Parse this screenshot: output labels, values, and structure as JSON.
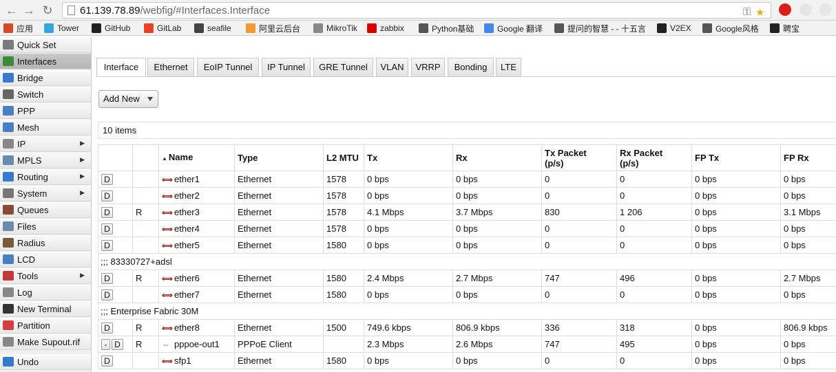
{
  "browser": {
    "url_host": "61.139.78.89",
    "url_path": "/webfig/#Interfaces.Interface"
  },
  "bookmarks": [
    {
      "label": "应用",
      "icon": "apps-grid-icon",
      "color": "#d04a30"
    },
    {
      "label": "Tower",
      "icon": "tower-icon",
      "color": "#3aa5d8"
    },
    {
      "label": "GitHub",
      "icon": "github-icon",
      "color": "#222222"
    },
    {
      "label": "GitLab",
      "icon": "gitlab-icon",
      "color": "#e2432a"
    },
    {
      "label": "seafile",
      "icon": "cloud-icon",
      "color": "#444444"
    },
    {
      "label": "阿里云后台",
      "icon": "aliyun-icon",
      "color": "#f29a38"
    },
    {
      "label": "MikroTik",
      "icon": "page-icon",
      "color": "#888888"
    },
    {
      "label": "zabbix",
      "icon": "zabbix-icon",
      "color": "#d40000"
    },
    {
      "label": "Python基础",
      "icon": "page-icon",
      "color": "#555555"
    },
    {
      "label": "Google 翻译",
      "icon": "translate-icon",
      "color": "#4a86e8"
    },
    {
      "label": "提问的智慧 - - 十五言",
      "icon": "page-icon",
      "color": "#555555"
    },
    {
      "label": "V2EX",
      "icon": "v2ex-icon",
      "color": "#222222"
    },
    {
      "label": "Google风格",
      "icon": "grid-icon",
      "color": "#555555"
    },
    {
      "label": "聘宝",
      "icon": "pinbao-icon",
      "color": "#222222"
    }
  ],
  "sidebar": {
    "items": [
      {
        "label": "Quick Set",
        "icon": "quick-set-icon",
        "color": "#7a7a7a",
        "arrow": ""
      },
      {
        "label": "Interfaces",
        "icon": "interfaces-icon",
        "color": "#3b8a3b",
        "arrow": ""
      },
      {
        "label": "Bridge",
        "icon": "bridge-icon",
        "color": "#3a78c8",
        "arrow": ""
      },
      {
        "label": "Switch",
        "icon": "switch-icon",
        "color": "#666666",
        "arrow": ""
      },
      {
        "label": "PPP",
        "icon": "ppp-icon",
        "color": "#4a7fc0",
        "arrow": ""
      },
      {
        "label": "Mesh",
        "icon": "mesh-icon",
        "color": "#4a7fc0",
        "arrow": ""
      },
      {
        "label": "IP",
        "icon": "ip-icon",
        "color": "#888888",
        "arrow": "▶"
      },
      {
        "label": "MPLS",
        "icon": "mpls-icon",
        "color": "#6a8ab0",
        "arrow": "▶"
      },
      {
        "label": "Routing",
        "icon": "routing-icon",
        "color": "#3a78c8",
        "arrow": "▶"
      },
      {
        "label": "System",
        "icon": "gear-icon",
        "color": "#777777",
        "arrow": "▶"
      },
      {
        "label": "Queues",
        "icon": "queues-icon",
        "color": "#8a4a3a",
        "arrow": ""
      },
      {
        "label": "Files",
        "icon": "files-icon",
        "color": "#6a8ab0",
        "arrow": ""
      },
      {
        "label": "Radius",
        "icon": "radius-icon",
        "color": "#7a5a3a",
        "arrow": ""
      },
      {
        "label": "LCD",
        "icon": "lcd-icon",
        "color": "#4a7fc0",
        "arrow": ""
      },
      {
        "label": "Tools",
        "icon": "tools-icon",
        "color": "#c03a3a",
        "arrow": "▶"
      },
      {
        "label": "Log",
        "icon": "log-icon",
        "color": "#888888",
        "arrow": ""
      },
      {
        "label": "New Terminal",
        "icon": "terminal-icon",
        "color": "#333333",
        "arrow": ""
      },
      {
        "label": "Partition",
        "icon": "partition-icon",
        "color": "#d04040",
        "arrow": ""
      },
      {
        "label": "Make Supout.rif",
        "icon": "supout-icon",
        "color": "#888888",
        "arrow": ""
      },
      {
        "label": "Undo",
        "icon": "undo-icon",
        "color": "#3a78c8",
        "arrow": ""
      }
    ]
  },
  "tabs": [
    "Interface",
    "Ethernet",
    "EoIP Tunnel",
    "IP Tunnel",
    "GRE Tunnel",
    "VLAN",
    "VRRP",
    "Bonding",
    "LTE"
  ],
  "toolbar": {
    "add_new_label": "Add New"
  },
  "items_count": "10 items",
  "table": {
    "columns": [
      "",
      "",
      "Name",
      "Type",
      "L2 MTU",
      "Tx",
      "Rx",
      "Tx Packet\n(p/s)",
      "Rx Packet\n(p/s)",
      "FP Tx",
      "FP Rx"
    ],
    "sort_indicator": "▲",
    "rows": [
      {
        "kind": "data",
        "minus": "",
        "d": "D",
        "flag": "",
        "name": "ether1",
        "type": "Ethernet",
        "mtu": "1578",
        "tx": "0 bps",
        "rx": "0 bps",
        "txp": "0",
        "rxp": "0",
        "fptx": "0 bps",
        "fprx": "0 bps"
      },
      {
        "kind": "data",
        "minus": "",
        "d": "D",
        "flag": "",
        "name": "ether2",
        "type": "Ethernet",
        "mtu": "1578",
        "tx": "0 bps",
        "rx": "0 bps",
        "txp": "0",
        "rxp": "0",
        "fptx": "0 bps",
        "fprx": "0 bps"
      },
      {
        "kind": "data",
        "minus": "",
        "d": "D",
        "flag": "R",
        "name": "ether3",
        "type": "Ethernet",
        "mtu": "1578",
        "tx": "4.1 Mbps",
        "rx": "3.7 Mbps",
        "txp": "830",
        "rxp": "1 206",
        "fptx": "0 bps",
        "fprx": "3.1 Mbps"
      },
      {
        "kind": "data",
        "minus": "",
        "d": "D",
        "flag": "",
        "name": "ether4",
        "type": "Ethernet",
        "mtu": "1578",
        "tx": "0 bps",
        "rx": "0 bps",
        "txp": "0",
        "rxp": "0",
        "fptx": "0 bps",
        "fprx": "0 bps"
      },
      {
        "kind": "data",
        "minus": "",
        "d": "D",
        "flag": "",
        "name": "ether5",
        "type": "Ethernet",
        "mtu": "1580",
        "tx": "0 bps",
        "rx": "0 bps",
        "txp": "0",
        "rxp": "0",
        "fptx": "0 bps",
        "fprx": "0 bps"
      },
      {
        "kind": "comment",
        "text": ";;; 83330727+adsl"
      },
      {
        "kind": "data",
        "minus": "",
        "d": "D",
        "flag": "R",
        "name": "ether6",
        "type": "Ethernet",
        "mtu": "1580",
        "tx": "2.4 Mbps",
        "rx": "2.7 Mbps",
        "txp": "747",
        "rxp": "496",
        "fptx": "0 bps",
        "fprx": "2.7 Mbps"
      },
      {
        "kind": "data",
        "minus": "",
        "d": "D",
        "flag": "",
        "name": "ether7",
        "type": "Ethernet",
        "mtu": "1580",
        "tx": "0 bps",
        "rx": "0 bps",
        "txp": "0",
        "rxp": "0",
        "fptx": "0 bps",
        "fprx": "0 bps"
      },
      {
        "kind": "comment",
        "text": ";;; Enterprise Fabric 30M"
      },
      {
        "kind": "data",
        "minus": "",
        "d": "D",
        "flag": "R",
        "name": "ether8",
        "type": "Ethernet",
        "mtu": "1500",
        "tx": "749.6 kbps",
        "rx": "806.9 kbps",
        "txp": "336",
        "rxp": "318",
        "fptx": "0 bps",
        "fprx": "806.9 kbps"
      },
      {
        "kind": "data",
        "minus": "-",
        "d": "D",
        "flag": "R",
        "name": "pppoe-out1",
        "type": "PPPoE Client",
        "mtu": "",
        "tx": "2.3 Mbps",
        "rx": "2.6 Mbps",
        "txp": "747",
        "rxp": "495",
        "fptx": "0 bps",
        "fprx": "0 bps"
      },
      {
        "kind": "data",
        "minus": "",
        "d": "D",
        "flag": "",
        "name": "sfp1",
        "type": "Ethernet",
        "mtu": "1580",
        "tx": "0 bps",
        "rx": "0 bps",
        "txp": "0",
        "rxp": "0",
        "fptx": "0 bps",
        "fprx": "0 bps"
      }
    ]
  }
}
